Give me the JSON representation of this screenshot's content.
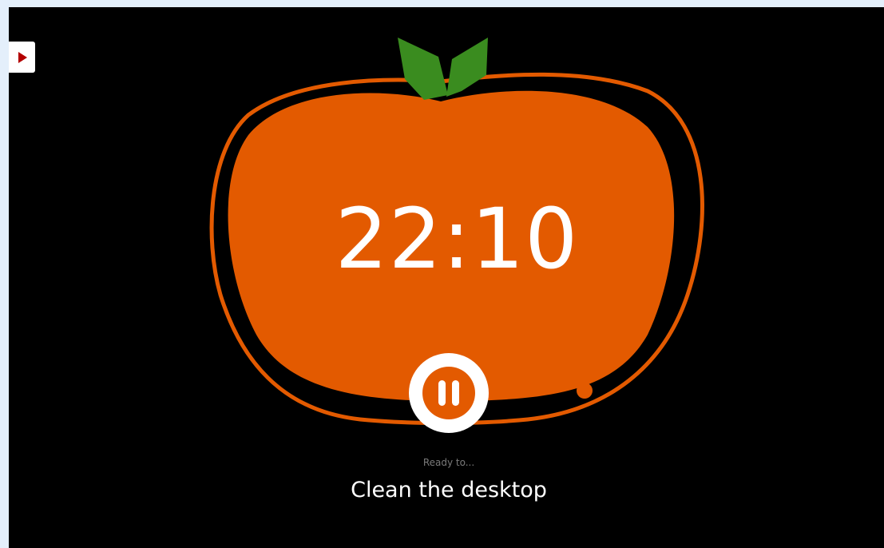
{
  "timer": {
    "time": "22:10",
    "state": "running"
  },
  "status": {
    "ready_label": "Ready to...",
    "task_label": "Clean the desktop"
  },
  "colors": {
    "tomato": "#e35a00",
    "leaf": "#3a8c1f",
    "background": "#000000",
    "page_background": "#e4effb",
    "toggle_arrow": "#b30000"
  },
  "icons": {
    "side_toggle": "play-triangle-icon",
    "pause_button": "pause-icon"
  }
}
